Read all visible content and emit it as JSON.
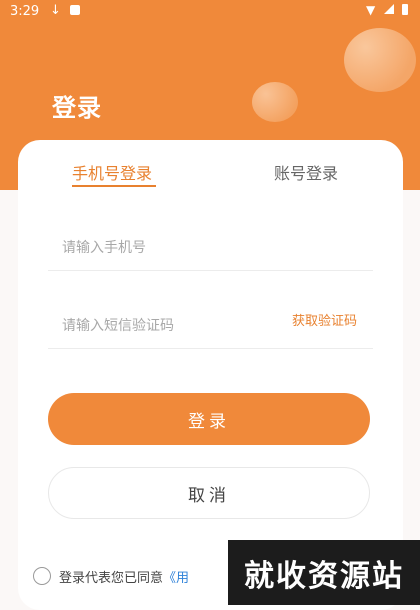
{
  "status_bar": {
    "time": "3:29",
    "icons": [
      "download-icon",
      "notification-icon",
      "wifi-icon",
      "signal-icon",
      "battery-icon"
    ]
  },
  "header": {
    "title": "登录"
  },
  "tabs": [
    {
      "label": "手机号登录",
      "active": true
    },
    {
      "label": "账号登录",
      "active": false
    }
  ],
  "form": {
    "phone_placeholder": "请输入手机号",
    "code_placeholder": "请输入短信验证码",
    "get_code_label": "获取验证码"
  },
  "buttons": {
    "login_label": "登录",
    "cancel_label": "取消"
  },
  "agreement": {
    "prefix": "登录代表您已同意",
    "link": "《用"
  },
  "watermark": {
    "text": "就收资源站"
  },
  "colors": {
    "accent": "#f0893a",
    "link": "#2f82d9"
  }
}
